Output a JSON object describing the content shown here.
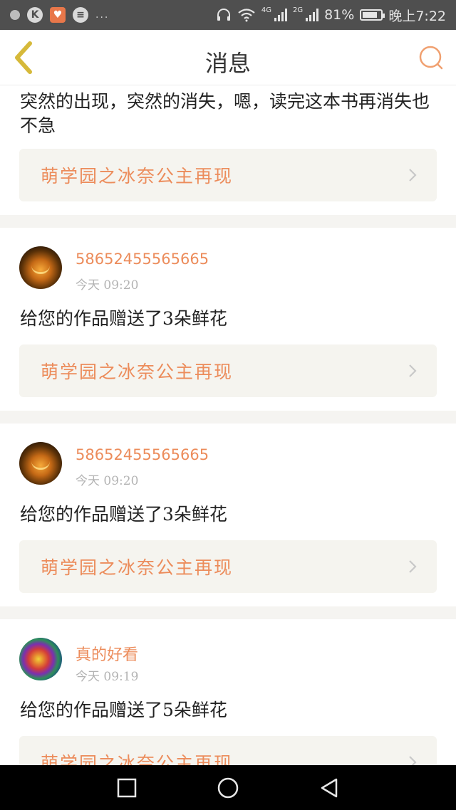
{
  "status_bar": {
    "net_4g": "4G",
    "net_2g": "2G",
    "battery": "81%",
    "battery_level": 0.81,
    "time": "晚上7:22",
    "icons": [
      "notification-icon",
      "k-app-icon",
      "heart-app-icon",
      "news-app-icon",
      "wifi-icon",
      "headset-icon",
      "signal-icon",
      "battery-icon"
    ]
  },
  "header": {
    "title": "消息",
    "back_icon": "chevron-left-icon",
    "search_icon": "search-icon",
    "accent": "#ec8c5b"
  },
  "messages": [
    {
      "text": "突然的出现，突然的消失，嗯，读完这本书再消失也不急",
      "work_title": "萌学园之冰奈公主再现"
    },
    {
      "username": "58652455565665",
      "time": "今天 09:20",
      "text": "给您的作品赠送了3朵鲜花",
      "work_title": "萌学园之冰奈公主再现",
      "avatar": "pumpkin"
    },
    {
      "username": "58652455565665",
      "time": "今天 09:20",
      "text": "给您的作品赠送了3朵鲜花",
      "work_title": "萌学园之冰奈公主再现",
      "avatar": "pumpkin"
    },
    {
      "username": "真的好看",
      "time": "今天 09:19",
      "text": "给您的作品赠送了5朵鲜花",
      "work_title": "萌学园之冰奈公主再现",
      "avatar": "rose"
    }
  ],
  "nav": {
    "icons": [
      "recent-apps-icon",
      "home-icon",
      "back-icon"
    ]
  }
}
